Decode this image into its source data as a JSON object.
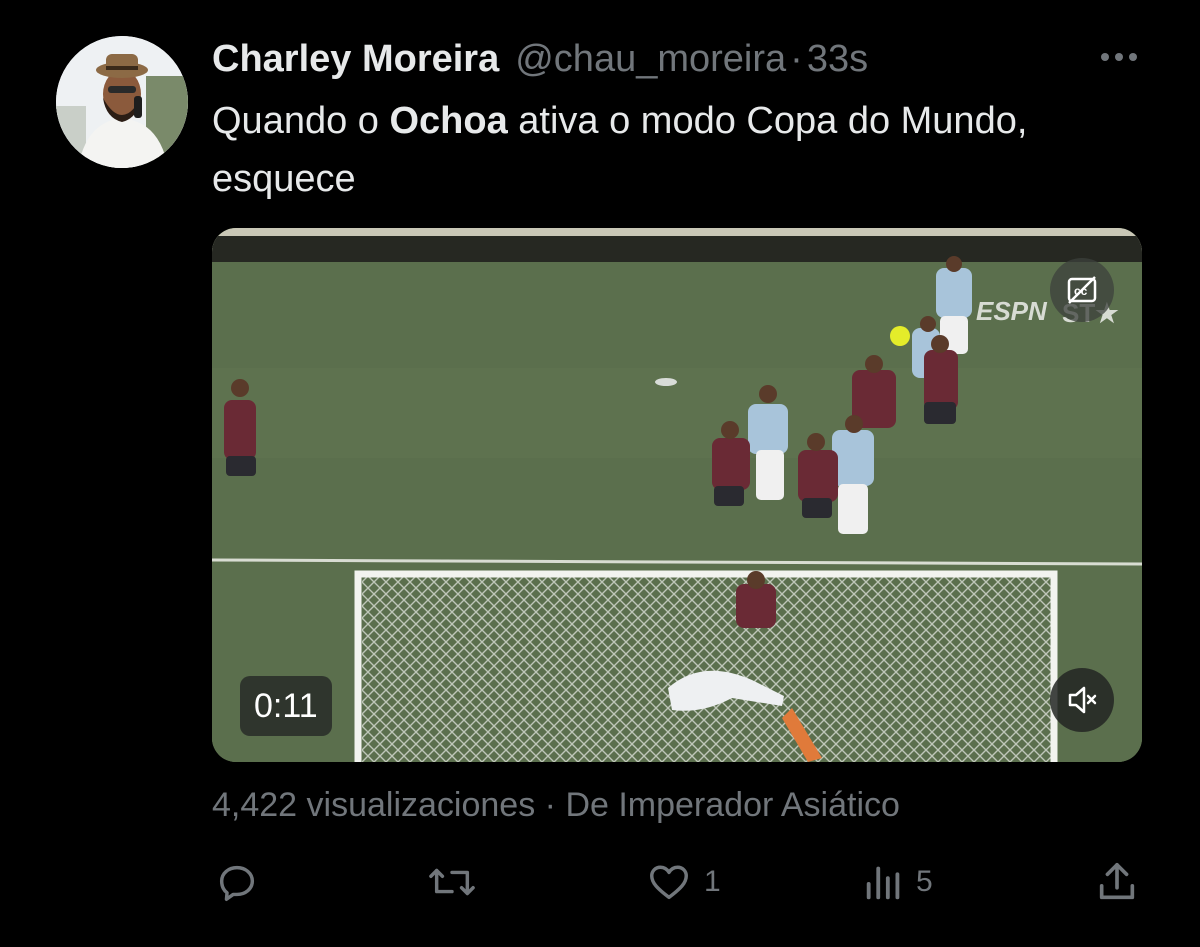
{
  "author": {
    "name": "Charley Moreira",
    "handle": "@chau_moreira",
    "separator": "·",
    "time": "33s"
  },
  "tweet": {
    "text_before": "Quando o ",
    "text_bold": "Ochoa",
    "text_after": " ativa o modo Copa do Mundo, esquece"
  },
  "video": {
    "duration": "0:11",
    "broadcaster_logo": "ESPN NO ST★",
    "cc_icon": "captions-icon",
    "mute_icon": "speaker-muted-icon"
  },
  "meta": {
    "views": "4,422 visualizaciones",
    "separator": "·",
    "source": "De Imperador Asiático"
  },
  "actions": {
    "reply": {
      "icon": "reply-icon",
      "count": ""
    },
    "retweet": {
      "icon": "retweet-icon",
      "count": ""
    },
    "like": {
      "icon": "heart-icon",
      "count": "1"
    },
    "views": {
      "icon": "analytics-icon",
      "count": "5"
    },
    "share": {
      "icon": "share-icon",
      "count": ""
    }
  },
  "colors": {
    "background": "#000000",
    "text_primary": "#e7e9ea",
    "text_secondary": "#71767b",
    "pitch_green": "#5a6d4e"
  }
}
